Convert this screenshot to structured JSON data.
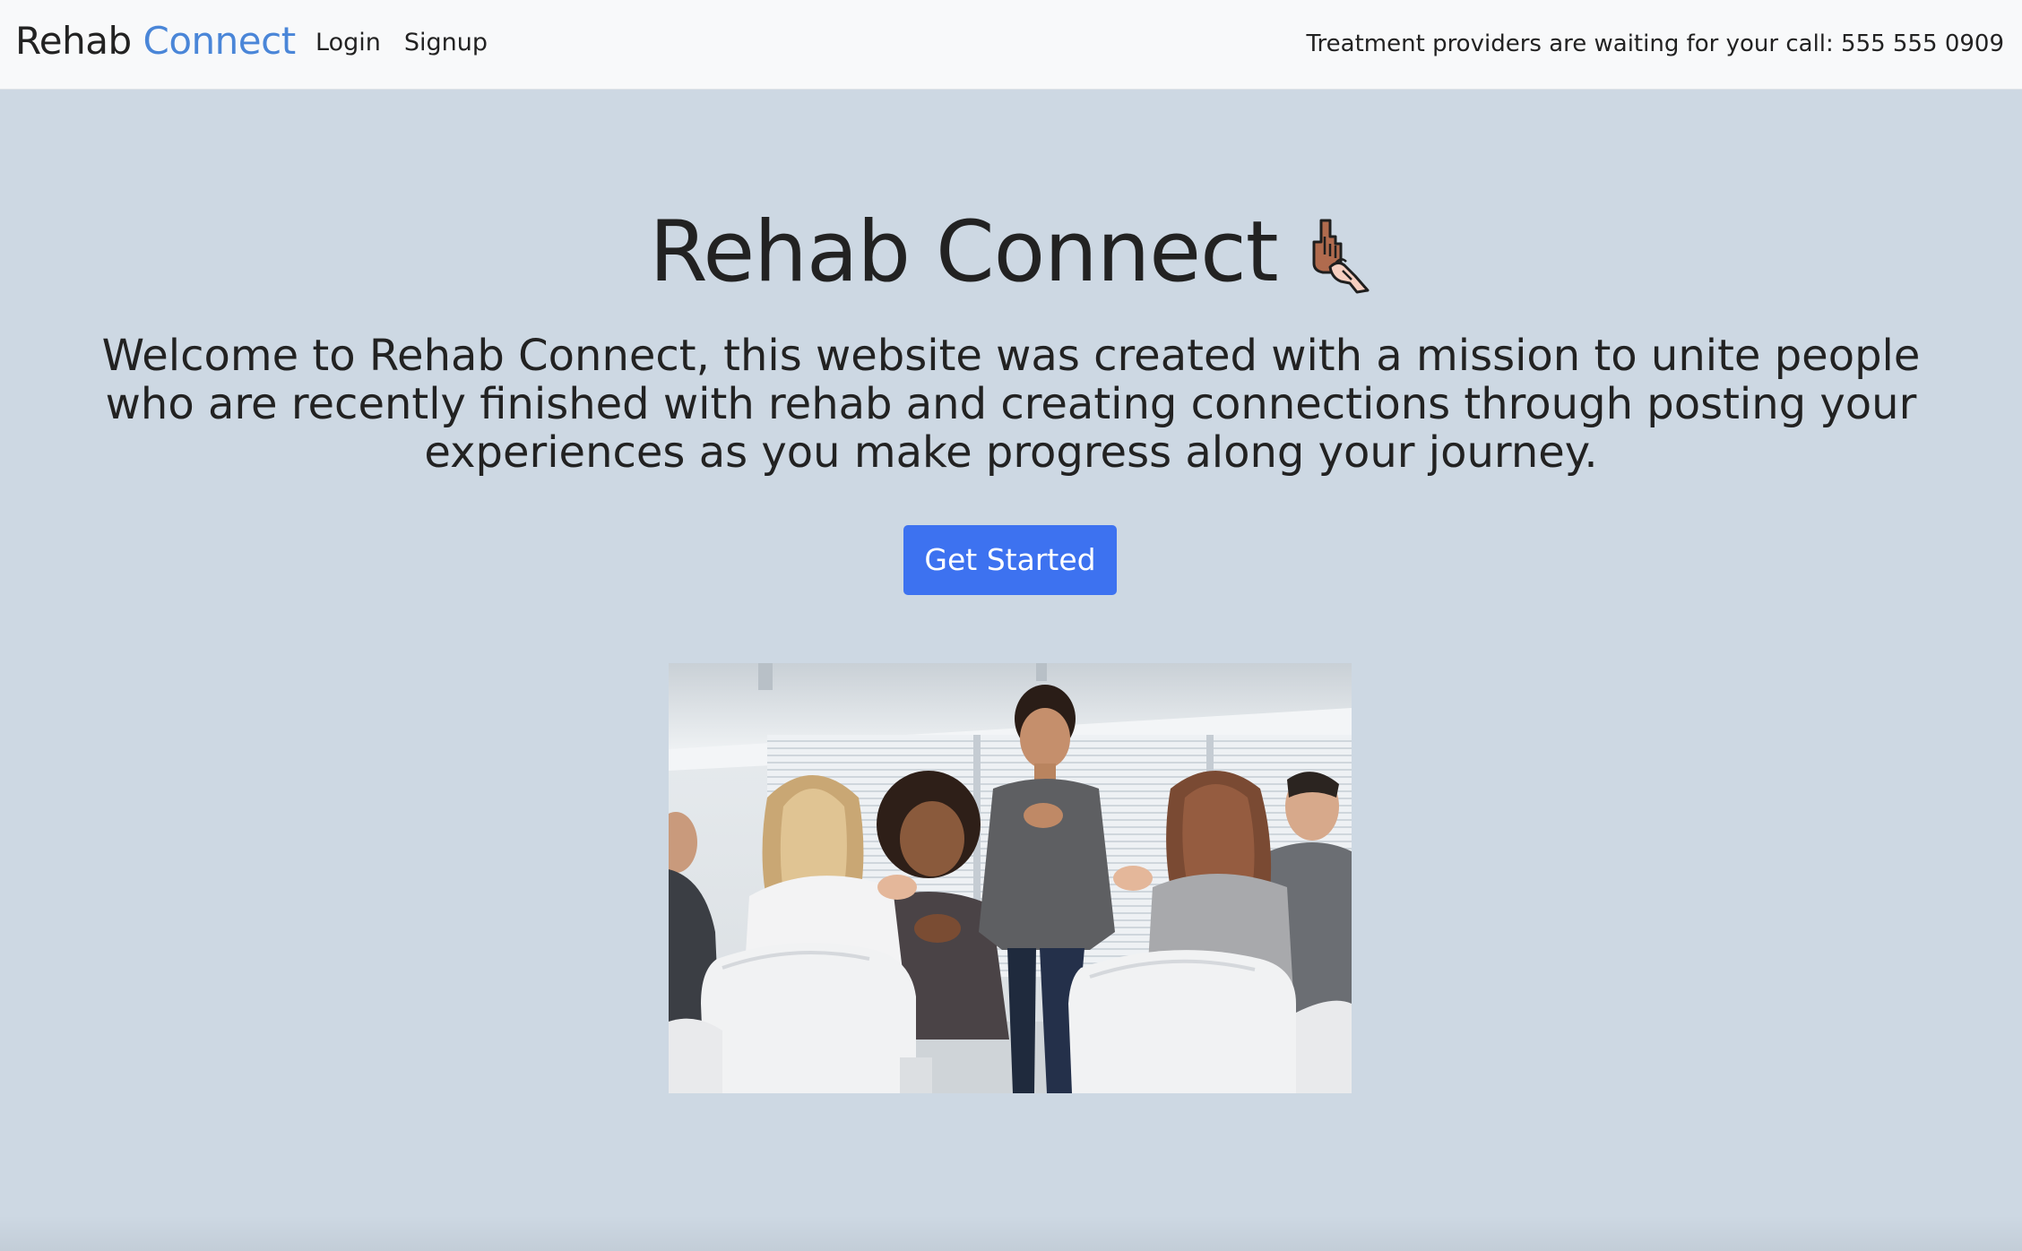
{
  "navbar": {
    "brand_part1": "Rehab",
    "brand_part2": "Connect",
    "links": [
      {
        "label": "Login"
      },
      {
        "label": "Signup"
      }
    ],
    "phone_notice": "Treatment providers are waiting for your call: 555 555 0909"
  },
  "hero": {
    "title": "Rehab Connect",
    "title_icon": "helping-hands-icon",
    "description": "Welcome to Rehab Connect, this website was created with a mission to unite people who are recently finished with rehab and creating connections through posting your experiences as you make progress along your journey.",
    "cta_label": "Get Started",
    "photo_subject": "support-group-photo"
  },
  "colors": {
    "background": "#cdd8e3",
    "navbar": "#f8f9fa",
    "brand_accent": "#4a86d8",
    "button": "#3d72f0",
    "text": "#222222"
  }
}
